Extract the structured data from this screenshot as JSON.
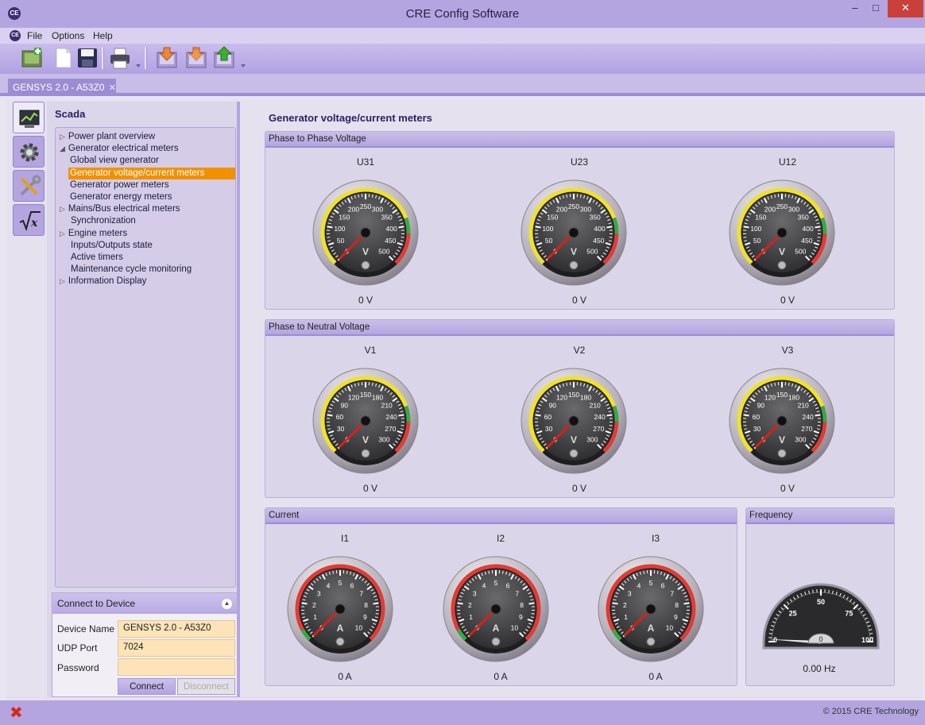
{
  "window": {
    "title": "CRE Config Software",
    "app_icon": "CE",
    "minimize": "–",
    "maximize": "□",
    "close": "✕"
  },
  "menu": {
    "icon": "CE",
    "items": [
      "File",
      "Options",
      "Help"
    ]
  },
  "toolbar": {
    "buttons": [
      "new-config-icon",
      "open-file-icon",
      "save-icon",
      "print-icon",
      "download-icon",
      "download-all-icon",
      "upload-icon"
    ]
  },
  "doc_tab": {
    "label": "GENSYS 2.0 - A53Z0",
    "close": "✕"
  },
  "sidebar": {
    "title": "Scada",
    "tree": [
      {
        "label": "Power plant overview",
        "level": 0,
        "arrow": "▷"
      },
      {
        "label": "Generator electrical meters",
        "level": 0,
        "arrow": "◢"
      },
      {
        "label": "Global view generator",
        "level": 1,
        "arrow": ""
      },
      {
        "label": "Generator voltage/current meters",
        "level": 1,
        "arrow": "",
        "selected": true
      },
      {
        "label": "Generator power meters",
        "level": 1,
        "arrow": ""
      },
      {
        "label": "Generator energy meters",
        "level": 1,
        "arrow": ""
      },
      {
        "label": "Mains/Bus electrical meters",
        "level": 0,
        "arrow": "▷"
      },
      {
        "label": "Synchronization",
        "level": 0,
        "arrow": ""
      },
      {
        "label": "Engine meters",
        "level": 0,
        "arrow": "▷"
      },
      {
        "label": "Inputs/Outputs state",
        "level": 0,
        "arrow": ""
      },
      {
        "label": "Active timers",
        "level": 0,
        "arrow": ""
      },
      {
        "label": "Maintenance cycle monitoring",
        "level": 0,
        "arrow": ""
      },
      {
        "label": "Information Display",
        "level": 0,
        "arrow": "▷"
      }
    ]
  },
  "connect": {
    "header": "Connect to Device",
    "collapse": "▲",
    "device_name_label": "Device Name",
    "device_name_value": "GENSYS 2.0 - A53Z0",
    "dropdown": "▼",
    "udp_port_label": "UDP Port",
    "udp_port_value": "7024",
    "password_label": "Password",
    "password_value": "",
    "connect_button": "Connect",
    "disconnect_button": "Disconnect"
  },
  "content": {
    "title": "Generator voltage/current meters",
    "groups": {
      "phase_phase": {
        "title": "Phase to Phase Voltage",
        "gauges": [
          {
            "label": "U31",
            "value": "0 V"
          },
          {
            "label": "U23",
            "value": "0 V"
          },
          {
            "label": "U12",
            "value": "0 V"
          }
        ]
      },
      "phase_neutral": {
        "title": "Phase to Neutral Voltage",
        "gauges": [
          {
            "label": "V1",
            "value": "0 V"
          },
          {
            "label": "V2",
            "value": "0 V"
          },
          {
            "label": "V3",
            "value": "0 V"
          }
        ]
      },
      "current": {
        "title": "Current",
        "gauges": [
          {
            "label": "I1",
            "value": "0 A"
          },
          {
            "label": "I2",
            "value": "0 A"
          },
          {
            "label": "I3",
            "value": "0 A"
          }
        ]
      },
      "frequency": {
        "title": "Frequency",
        "value": "0.00 Hz"
      }
    }
  },
  "gauge_scales": {
    "ph_ph": {
      "unit": "V",
      "ticks": [
        "0",
        "50",
        "100",
        "150",
        "200",
        "250",
        "300",
        "350",
        "400",
        "450",
        "500"
      ]
    },
    "ph_n": {
      "unit": "V",
      "ticks": [
        "0",
        "30",
        "60",
        "90",
        "120",
        "150",
        "180",
        "210",
        "240",
        "270",
        "300"
      ]
    },
    "current": {
      "unit": "A",
      "ticks": [
        "0",
        "1",
        "2",
        "3",
        "4",
        "5",
        "6",
        "7",
        "8",
        "9",
        "10"
      ]
    },
    "frequency": {
      "ticks": [
        "0",
        "25",
        "50",
        "75",
        "100"
      ],
      "center_value": "0"
    }
  },
  "colors": {
    "accent": "#b4a5e0",
    "selection": "#f29100",
    "zone_yellow": "#f0e12a",
    "zone_green": "#3aa845",
    "zone_red": "#e23b35",
    "needle": "#d8201a"
  },
  "statusbar": {
    "error_icon": "✖",
    "copyright": "© 2015 CRE Technology"
  }
}
